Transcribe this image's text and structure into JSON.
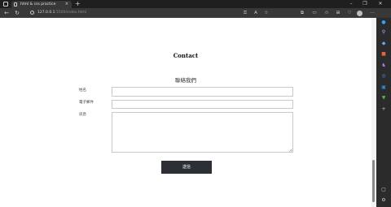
{
  "browser": {
    "tab": {
      "title": "html & css practice",
      "close_glyph": "×"
    },
    "new_tab_glyph": "+",
    "window_controls": {
      "minimize": "–",
      "maximize": "❐",
      "close": "✕"
    },
    "nav": {
      "back": "←",
      "refresh": "↻"
    },
    "address": {
      "host": "127.0.0.1",
      "path": ":5500/index.html"
    },
    "toolbar_icons": [
      "key-icon",
      "translate-icon",
      "star-icon",
      "extension-icon",
      "split-screen-icon",
      "favorites-icon",
      "collections-icon",
      "performance-icon",
      "profile-icon",
      "more-icon"
    ],
    "sidebar_icons": [
      "search-icon",
      "tag-icon",
      "briefcase-icon",
      "games-icon",
      "ms365-icon",
      "outlook-icon",
      "tools-icon",
      "add-icon"
    ],
    "colors": {
      "tabstrip": "#1f1f1f",
      "toolbar": "#383838",
      "sidebar": "#2b2b2b"
    }
  },
  "page": {
    "heading": "Contact",
    "form": {
      "title": "聯絡我們",
      "name_label": "姓名",
      "email_label": "電子郵件",
      "message_label": "訊息",
      "name_value": "",
      "email_value": "",
      "message_value": "",
      "submit_label": "送信"
    },
    "colors": {
      "button_bg": "#2c3036",
      "field_border": "#c9c9c9"
    }
  }
}
